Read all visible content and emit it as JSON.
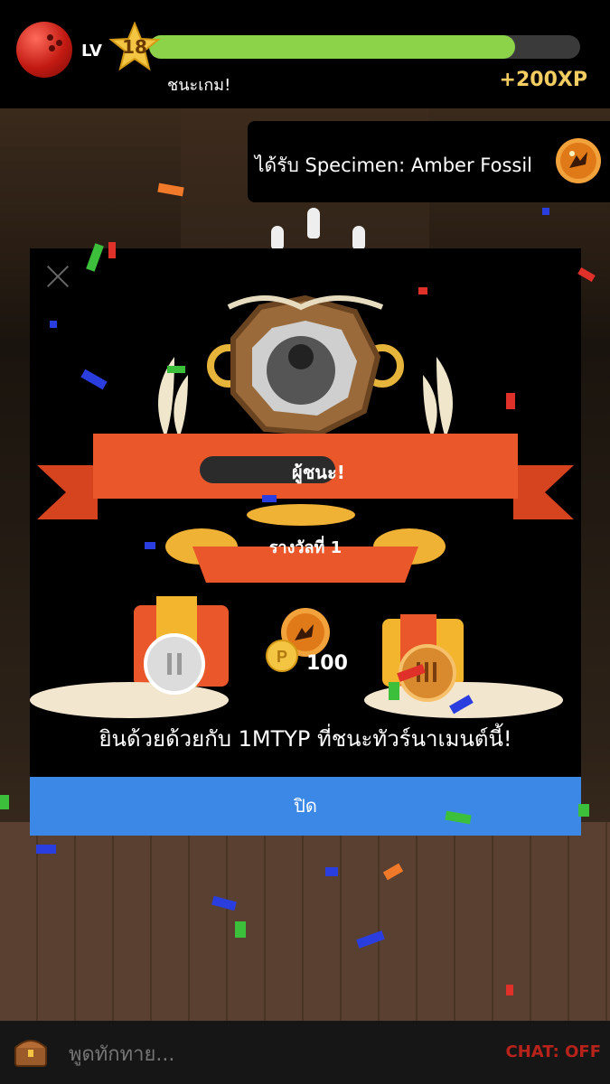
{
  "header": {
    "level_label": "LV",
    "level": "18",
    "xp_progress": 0.85,
    "status": "ชนะเกม!",
    "xp_gain": "+200XP"
  },
  "toast": {
    "text": "ได้รับ Specimen: Amber Fossil",
    "icon": "amber-fossil-icon"
  },
  "modal": {
    "winner_suffix": "ผู้ชนะ!",
    "place_label": "รางวัลที่ 1",
    "reward_icon": "amber-fossil-icon",
    "coin_amount": "100",
    "congrats": "ยินด้วยด้วยกับ 1MTYP ที่ชนะทัวร์นาเมนต์นี้!",
    "close_label": "ปิด"
  },
  "chat": {
    "placeholder": "พูดทักทาย...",
    "status": "CHAT: OFF"
  },
  "colors": {
    "accent_blue": "#3c88e6",
    "xp_green": "#8cd34a",
    "xp_gold": "#f3cd62",
    "ribbon_red": "#e9572a",
    "chat_off_red": "#b7231a"
  }
}
